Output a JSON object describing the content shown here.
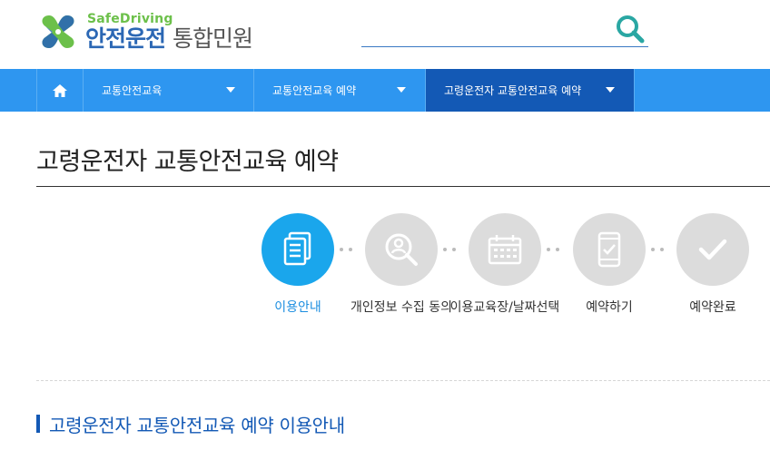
{
  "header": {
    "logo_sub": "SafeDriving",
    "logo_main": "안전운전",
    "logo_tail": "통합민원",
    "search_placeholder": "",
    "colors": {
      "logo_green": "#6cc04a",
      "logo_blue": "#2b67b4",
      "search_icon": "#2aa7a3"
    }
  },
  "nav": {
    "home_icon": "home-icon",
    "items": [
      {
        "label": "교통안전교육"
      },
      {
        "label": "교통안전교육 예약"
      },
      {
        "label": "고령운전자 교통안전교육 예약",
        "active": true
      }
    ],
    "colors": {
      "bar": "#2e96f0",
      "active": "#1359b5"
    }
  },
  "page": {
    "title": "고령운전자 교통안전교육 예약",
    "section_title": "고령운전자 교통안전교육 예약 이용안내"
  },
  "steps": [
    {
      "label": "이용안내",
      "icon": "document-icon",
      "active": true
    },
    {
      "label": "개인정보 수집 동의",
      "icon": "person-search-icon",
      "active": false
    },
    {
      "label": "이용교육장/날짜선택",
      "icon": "calendar-icon",
      "active": false
    },
    {
      "label": "예약하기",
      "icon": "phone-check-icon",
      "active": false
    },
    {
      "label": "예약완료",
      "icon": "check-icon",
      "active": false
    }
  ]
}
